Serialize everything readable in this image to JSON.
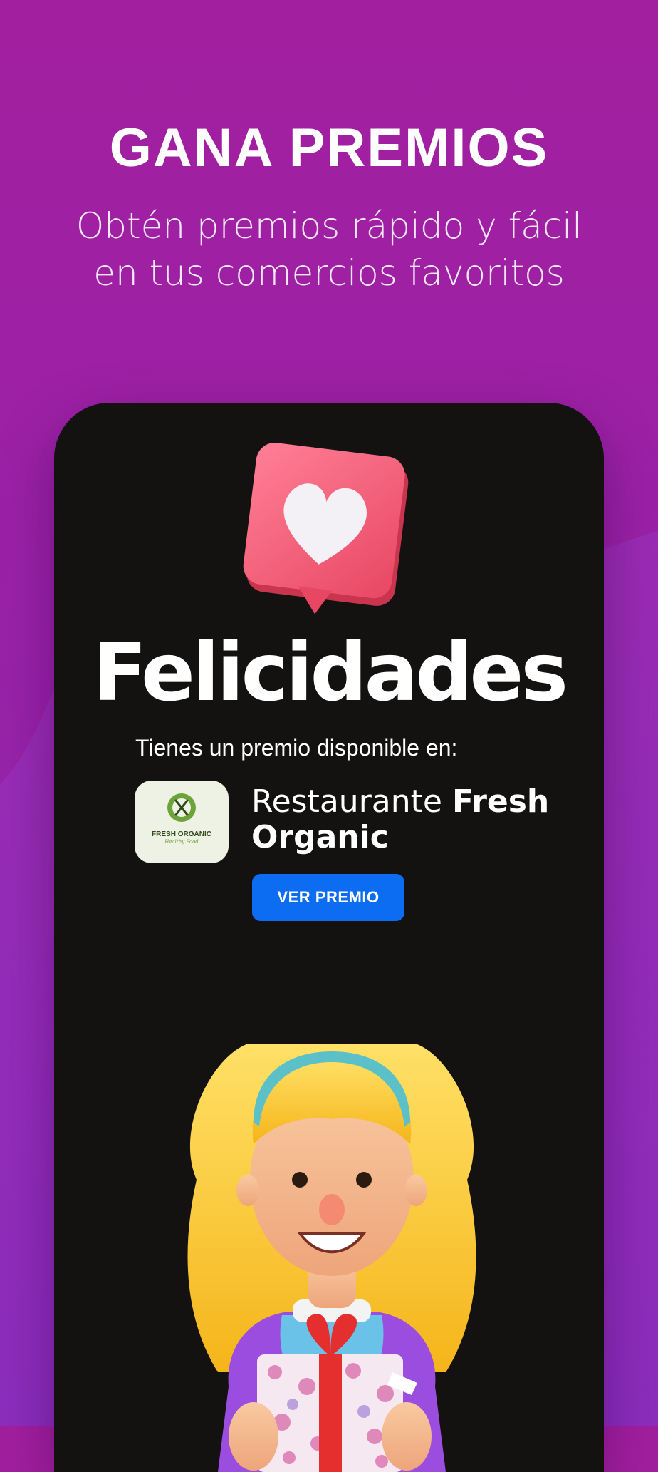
{
  "header": {
    "title": "GANA PREMIOS",
    "subtitle": "Obtén premios rápido y fácil en tus comercios favoritos"
  },
  "card": {
    "heading": "Felicidades",
    "available_text": "Tienes un premio disponible en:",
    "merchant": {
      "name_prefix": "Restaurante",
      "name_highlight": "Fresh Organic",
      "logo_name": "FRESH ORGANIC",
      "logo_tagline": "Healthy Food"
    },
    "button_label": "VER PREMIO"
  },
  "icons": {
    "like": "heart-speech-bubble-icon",
    "logo": "fork-spoon-leaf-icon"
  },
  "colors": {
    "background_top": "#a21f9f",
    "background_bottom": "#8e27b6",
    "card_background": "#141111",
    "bubble": "#f7617c",
    "button": "#0c6cf2"
  }
}
